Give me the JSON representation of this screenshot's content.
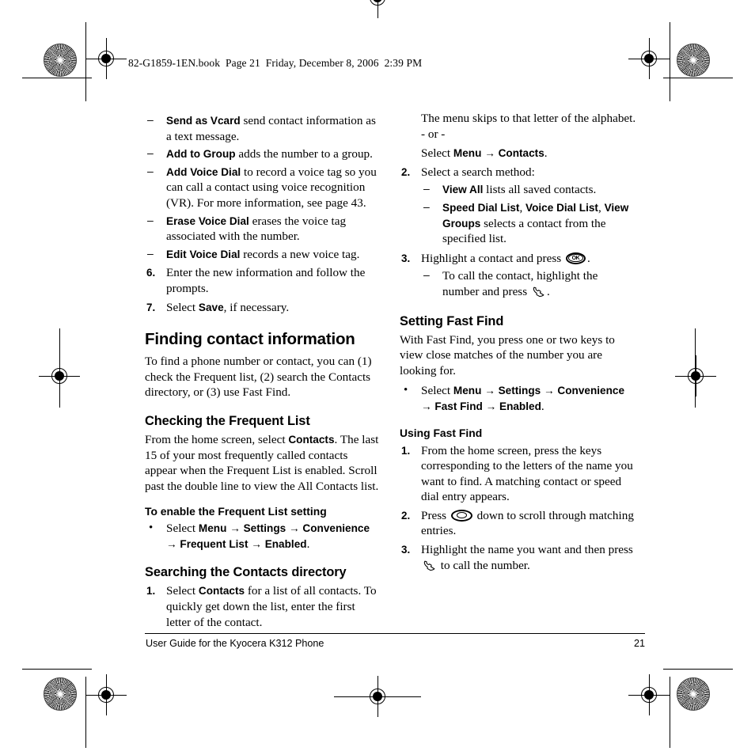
{
  "document": {
    "book_line": "82-G1859-1EN.book  Page 21  Friday, December 8, 2006  2:39 PM",
    "footer_title": "User Guide for the Kyocera K312 Phone",
    "page_number": "21"
  },
  "left_column": {
    "options": [
      {
        "marker": "–",
        "bold": "Send as Vcard",
        "text": " send contact information as a text message."
      },
      {
        "marker": "–",
        "bold": "Add to Group",
        "text": " adds the number to a group."
      },
      {
        "marker": "–",
        "bold": "Add Voice Dial",
        "text": " to record a voice tag so you can call a contact using voice recognition (VR). For more information, see page 43."
      },
      {
        "marker": "–",
        "bold": "Erase Voice Dial",
        "text": " erases the voice tag associated with the number."
      },
      {
        "marker": "–",
        "bold": "Edit Voice Dial",
        "text": " records a new voice tag."
      }
    ],
    "steps": [
      {
        "marker": "6.",
        "text": "Enter the new information and follow the prompts."
      },
      {
        "marker": "7.",
        "pre": "Select ",
        "bold": "Save",
        "post": ", if necessary."
      }
    ],
    "heading_finding": "Finding contact information",
    "finding_body": "To find a phone number or contact, you can (1) check the Frequent list, (2) search the Contacts directory, or (3) use Fast Find.",
    "heading_frequent": "Checking the Frequent List",
    "frequent_body_1": "From the home screen, select ",
    "frequent_body_bold": "Contacts",
    "frequent_body_2": ". The last 15 of your most frequently called contacts appear when the Frequent List is enabled. Scroll past the double line to view the All Contacts list.",
    "heading_enable_frequent": "To enable the Frequent List setting",
    "enable_bullet": {
      "marker": "•",
      "pre": "Select ",
      "path": [
        "Menu",
        "Settings",
        "Convenience",
        "Frequent List",
        "Enabled"
      ],
      "arrow": "→",
      "post": "."
    },
    "heading_searching": "Searching the Contacts directory",
    "search_step_1": {
      "marker": "1.",
      "pre": "Select ",
      "bold": "Contacts",
      "post": " for a list of all contacts. To quickly get down the list, enter the first letter of the contact."
    }
  },
  "right_column": {
    "cont_line_1": "The menu skips to that letter of the alphabet.",
    "cont_line_2": "- or -",
    "cont_select": {
      "pre": "Select ",
      "path": [
        "Menu",
        "Contacts"
      ],
      "arrow": "→",
      "post": "."
    },
    "step_2": {
      "marker": "2.",
      "text": "Select a search method:",
      "sub": [
        {
          "marker": "–",
          "bold": "View All",
          "text": " lists all saved contacts."
        },
        {
          "marker": "–",
          "bold_parts": [
            "Speed Dial List",
            "Voice Dial List",
            "View Groups"
          ],
          "text": " selects a contact from the specified list."
        }
      ]
    },
    "step_3": {
      "marker": "3.",
      "pre": "Highlight a contact and press ",
      "icon": "ok-key-icon",
      "post": ".",
      "sub": {
        "marker": "–",
        "pre": "To call the contact, highlight the number and press ",
        "icon": "send-key-icon",
        "post": "."
      }
    },
    "heading_setting_fast_find": "Setting Fast Find",
    "fast_find_body": "With Fast Find, you press one or two keys to view close matches of the number you are looking for.",
    "fast_find_bullet": {
      "marker": "•",
      "pre": "Select ",
      "path": [
        "Menu",
        "Settings",
        "Convenience",
        "Fast Find",
        "Enabled"
      ],
      "arrow": "→",
      "post": "."
    },
    "heading_using_fast_find": "Using Fast Find",
    "using_steps": [
      {
        "marker": "1.",
        "text": "From the home screen, press the keys corresponding to the letters of the name you want to find. A matching contact or speed dial entry appears."
      },
      {
        "marker": "2.",
        "pre": "Press ",
        "icon": "navigation-key-icon",
        "post": " down to scroll through matching entries."
      },
      {
        "marker": "3.",
        "pre": "Highlight the name you want and then press ",
        "icon": "send-key-icon",
        "post": " to call the number."
      }
    ]
  }
}
